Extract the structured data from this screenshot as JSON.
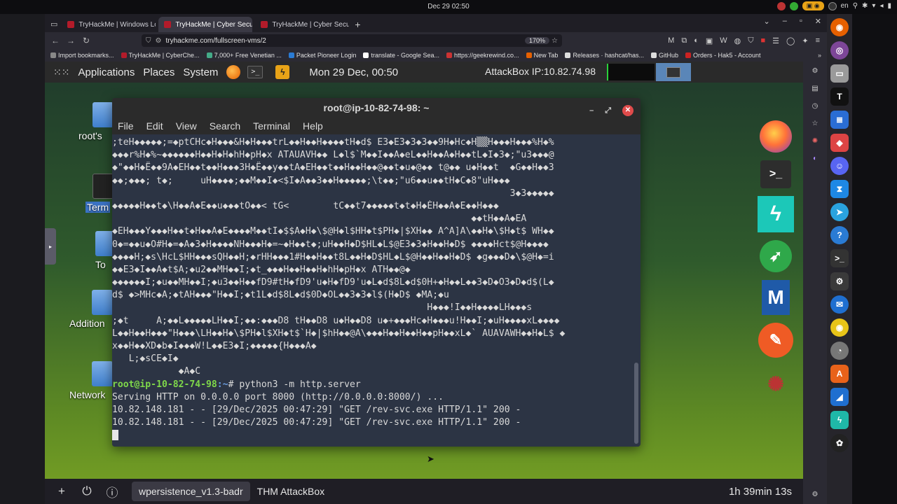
{
  "os": {
    "clock": "Dec 29  02:50",
    "lang": "en"
  },
  "browser": {
    "tabs": [
      {
        "title": "TryHackMe | Windows Lo"
      },
      {
        "title": "TryHackMe | Cyber Securi"
      },
      {
        "title": "TryHackMe | Cyber Securi"
      }
    ],
    "url": "tryhackme.com/fullscreen-vms/2",
    "zoom": "170%",
    "bookmarks": [
      "Import bookmarks...",
      "TryHackMe | CyberChe...",
      "7,000+ Free Venetian ...",
      "Packet Pioneer Login",
      "translate - Google Sea...",
      "https://geekrewind.co...",
      "New Tab",
      "Releases · hashcat/has...",
      "GitHub",
      "Orders - Hak5 - Account"
    ]
  },
  "panel": {
    "applications": "Applications",
    "places": "Places",
    "system": "System",
    "datetime": "Mon 29 Dec, 00:50",
    "attackbox_ip": "AttackBox IP:10.82.74.98"
  },
  "desktop": {
    "icons": [
      "root's",
      "Term",
      "To",
      "Addition",
      "Network"
    ]
  },
  "terminal": {
    "title": "root@ip-10-82-74-98: ~",
    "menu": [
      "File",
      "Edit",
      "View",
      "Search",
      "Terminal",
      "Help"
    ],
    "lines": [
      ";teH◆◆◆◆◆;=◆ptCHc◆H◆◆◆&H◆H◆◆◆trL◆◆H◆◆H◆◆◆◆tH◆d$ E3◆E3◆3◆3◆◆9H◆Hc◆H▒▒H◆◆◆H◆◆◆%H◆%",
      "◆◆◆r%H◆%~◆◆◆◆◆◆H◆◆H◆H◆hH◆pH◆x ATAUAVH◆◆ L◆l$`M◆◆I◆◆A◆eL◆◆H◆◆A◆H◆◆tL◆I◆3◆;\"u3◆◆◆@",
      "◆\"◆◆H◆Ë◆◆9A◆EH◆◆t◆◆H◆◆◆3H◆Ë◆◆y◆◆tA◆EH◆◆t◆◆H◆◆H◆◆@◆◆t◆u◆@◆◆ t@◆◆ u◆H◆◆t  ◆G◆◆H◆◆3",
      "◆◆;◆◆◆; t◆;     uH◆◆◆◆;◆◆M◆◆I◆<$I◆A◆◆3◆◆H◆◆◆◆◆;\\t◆◆;\"u6◆◆u◆◆tH◆C◆8\"uH◆◆◆",
      "                                                                        3◆3◆◆◆◆◆",
      "◆◆◆◆◆H◆◆t◆\\H◆◆A◆E◆◆u◆◆◆tO◆◆< tG<        tC◆◆t7◆◆◆◆◆t◆t◆H◆ÈH◆◆A◆E◆◆H◆◆◆",
      "                                                                 ◆◆tH◆◆A◆EA",
      "◆EH◆◆◆Y◆◆◆H◆◆t◆H◆◆A◆E◆◆◆◆M◆◆tI◆$$A◆H◆\\$@H◆l$HH◆t$PH◆|$XH◆◆ A^A]A\\◆◆H◆\\$H◆t$ WH◆◆",
      "0◆=◆◆u◆O#H◆=◆A◆3◆H◆◆◆◆NH◆◆◆H◆=~◆H◆◆t◆;uH◆◆H◆D$HL◆L$@E3◆3◆H◆◆H◆D$ ◆◆◆◆Hct$@H◆◆◆◆",
      "◆◆◆◆H;◆s\\HcL$HH◆◆◆sQH◆◆H;◆rHH◆◆◆1#H◆◆H◆◆t8L◆◆H◆D$HL◆L$@H◆◆H◆◆H◆D$ ◆g◆◆◆D◆\\$@H◆=i",
      "◆◆E3◆I◆◆A◆t$A;◆u2◆◆MH◆◆I;◆t_◆◆◆H◆◆H◆◆H◆hH◆pH◆x ATH◆◆@◆",
      "◆◆◆◆◆◆I;◆u◆◆MH◆◆I;◆u3◆◆H◆◆fD9#tH◆fD9'u◆H◆fD9'u◆L◆d$8L◆d$0H+◆H◆◆L◆◆3◆D◆O3◆D◆d$(L◆",
      "d$ ◆>MHc◆A;◆tAH◆◆◆\"H◆◆I;◆t1L◆d$8L◆d$0D◆OL◆◆3◆3◆l$(H◆D$ ◆MA;◆u",
      "                                                         H◆◆◆!I◆◆H◆◆◆◆LH◆◆◆s",
      ";◆t     A;◆◆L◆◆◆◆◆LH◆◆I;◆◆:◆◆◆D8 tH◆◆D8 u◆H◆◆D8 u◆+◆◆◆Hc◆H◆◆◆u!H◆◆I;◆uH◆◆◆◆xL◆◆◆◆",
      "L◆◆H◆◆H◆◆◆\"H◆◆◆\\LH◆◆H◆\\$PH◆l$XH◆t$`H◆|$hH◆◆@A\\◆◆◆H◆◆H◆◆H◆◆pH◆◆xL◆` AUAVAWH◆◆H◆L$ ◆",
      "x◆◆H◆◆XD◆b◆I◆◆◆W!L◆◆E3◆I;◆◆◆◆◆{H◆◆◆A◆",
      "   L;◆sCE◆I◆",
      "            ◆A◆C"
    ],
    "prompt_user": "root@ip-10-82-74-98",
    "prompt_path": ":~",
    "command": "# python3 -m http.server",
    "output": [
      "Serving HTTP on 0.0.0.0 port 8000 (http://0.0.0.0:8000/) ...",
      "10.82.148.181 - - [29/Dec/2025 00:47:29] \"GET /rev-svc.exe HTTP/1.1\" 200 -",
      "10.82.148.181 - - [29/Dec/2025 00:47:29] \"GET /rev-svc.exe HTTP/1.1\" 200 -"
    ]
  },
  "bottom": {
    "tab_active": "wpersistence_v1.3-badr",
    "tab_other": "THM AttackBox",
    "timer": "1h 39min 13s"
  }
}
